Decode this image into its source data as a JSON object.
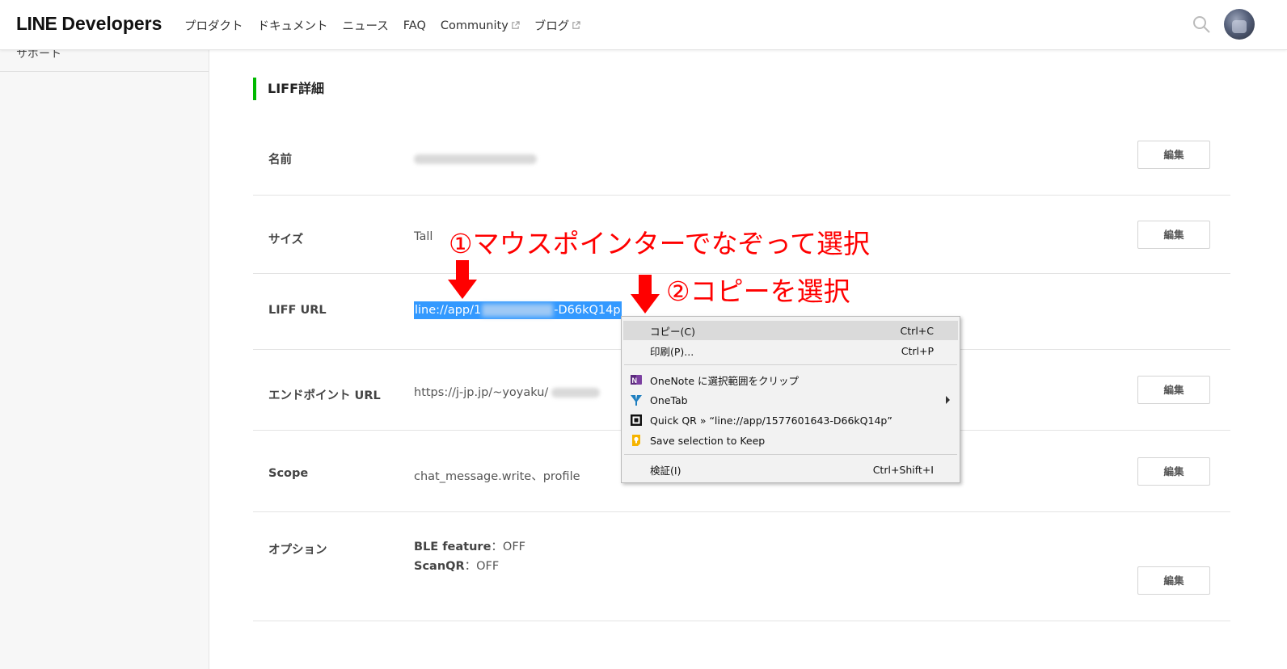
{
  "header": {
    "logo_line": "LINE",
    "logo_dev": "Developers",
    "nav": [
      {
        "label": "プロダクト",
        "external": false
      },
      {
        "label": "ドキュメント",
        "external": false
      },
      {
        "label": "ニュース",
        "external": false
      },
      {
        "label": "FAQ",
        "external": false
      },
      {
        "label": "Community",
        "external": true
      },
      {
        "label": "ブログ",
        "external": true
      }
    ],
    "search_icon": "search-icon",
    "avatar": "user-avatar"
  },
  "sidebar": {
    "cut_item": "サポート"
  },
  "section_title": "LIFF詳細",
  "rows": {
    "name": {
      "label": "名前",
      "value_blurred": true,
      "edit": "編集"
    },
    "size": {
      "label": "サイズ",
      "value": "Tall",
      "edit": "編集"
    },
    "liff_url": {
      "label": "LIFF URL",
      "value_prefix": "line://app/1",
      "value_suffix": "-D66kQ14p"
    },
    "endpoint": {
      "label": "エンドポイント URL",
      "value": "https://j-jp.jp/~yoyaku/",
      "edit": "編集"
    },
    "scope": {
      "label": "Scope",
      "value": "chat_message.write、profile",
      "edit": "編集"
    },
    "options": {
      "label": "オプション",
      "ble_label": "BLE feature",
      "ble_sep": "：",
      "ble_value": "OFF",
      "scanqr_label": "ScanQR",
      "scanqr_sep": "：",
      "scanqr_value": "OFF",
      "edit": "編集"
    }
  },
  "annotations": {
    "step1": "①マウスポインターでなぞって選択",
    "step2": "②コピーを選択"
  },
  "context_menu": {
    "copy": {
      "label": "コピー(C)",
      "shortcut": "Ctrl+C"
    },
    "print": {
      "label": "印刷(P)...",
      "shortcut": "Ctrl+P"
    },
    "onenote": {
      "label": "OneNote に選択範囲をクリップ",
      "icon": "onenote-icon"
    },
    "onetab": {
      "label": "OneTab",
      "icon": "onetab-icon"
    },
    "quickqr": {
      "label": "Quick QR » “line://app/1577601643-D66kQ14p”",
      "icon": "qr-icon"
    },
    "keep": {
      "label": "Save selection to Keep",
      "icon": "keep-icon"
    },
    "inspect": {
      "label": "検証(I)",
      "shortcut": "Ctrl+Shift+I"
    }
  },
  "colors": {
    "accent_green": "#00b900",
    "selection": "#3399ff",
    "annotation_red": "#ff0000"
  }
}
